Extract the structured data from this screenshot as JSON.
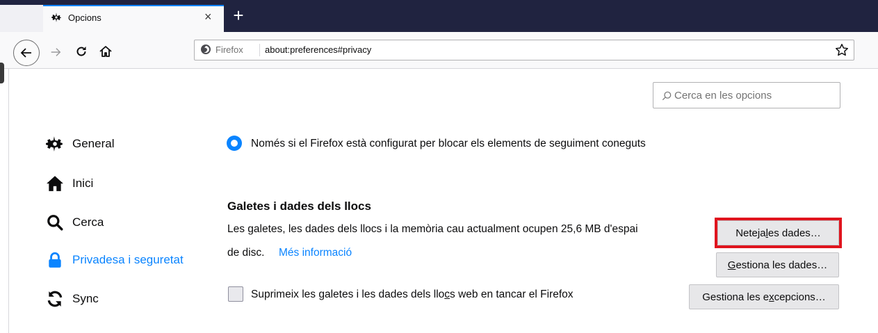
{
  "tab": {
    "title": "Opcions",
    "close_glyph": "×",
    "new_tab_glyph": "+"
  },
  "toolbar": {
    "url_identity": "Firefox",
    "url": "about:preferences#privacy"
  },
  "search": {
    "placeholder": "Cerca en les opcions"
  },
  "sidebar": {
    "items": [
      {
        "label": "General",
        "icon": "gear-icon"
      },
      {
        "label": "Inici",
        "icon": "home-icon"
      },
      {
        "label": "Cerca",
        "icon": "search-icon"
      },
      {
        "label": "Privadesa i seguretat",
        "icon": "lock-icon",
        "selected": true
      },
      {
        "label": "Sync",
        "icon": "sync-icon"
      }
    ]
  },
  "content": {
    "radio_label": "Només si el Firefox està configurat per blocar els elements de seguiment coneguts",
    "section_title": "Galetes i dades dels llocs",
    "desc_line1": "Les galetes, les dades dels llocs i la memòria cau actualment ocupen 25,6 MB d'espai",
    "desc_line2": "de disc.",
    "more_info": "Més informació",
    "checkbox_pre": "Suprimeix les galetes i les dades dels llo",
    "checkbox_ul": "c",
    "checkbox_post": "s web en tancar el Firefox",
    "buttons": {
      "clear_pre": "Neteja ",
      "clear_ul": "l",
      "clear_post": "es dades…",
      "manage_ul": "G",
      "manage_post": "estiona les dades…",
      "exceptions_pre": "Gestiona les e",
      "exceptions_ul": "x",
      "exceptions_post": "cepcions…"
    }
  },
  "colors": {
    "accent": "#0a84ff",
    "highlight": "#e0141e",
    "tabstrip": "#202340"
  }
}
